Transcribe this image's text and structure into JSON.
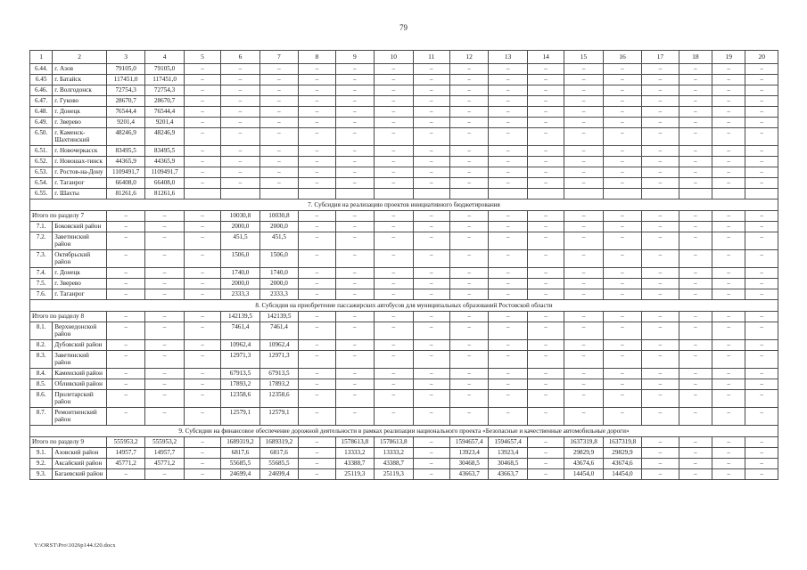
{
  "document": {
    "page_number": "79",
    "footer_path": "Y:\\ORST\\Pro\\1026p144.f20.docx"
  },
  "table": {
    "column_numbers": [
      "1",
      "2",
      "3",
      "4",
      "5",
      "6",
      "7",
      "8",
      "9",
      "10",
      "11",
      "12",
      "13",
      "14",
      "15",
      "16",
      "17",
      "18",
      "19",
      "20"
    ],
    "dash": "–",
    "blocks": [
      {
        "id": "block-6-continued",
        "section_header": null,
        "total_row": null,
        "rows": [
          {
            "num": "6.44.",
            "name": "г. Азов",
            "values": [
              "79105,0",
              "79105,0",
              "–",
              "–",
              "–",
              "–",
              "–",
              "–",
              "–",
              "–",
              "–",
              "–",
              "–",
              "–",
              "–",
              "–",
              "–",
              "–"
            ]
          },
          {
            "num": "6.45",
            "name": "г. Батайск",
            "values": [
              "117451,0",
              "117451,0",
              "–",
              "–",
              "–",
              "–",
              "–",
              "–",
              "–",
              "–",
              "–",
              "–",
              "–",
              "–",
              "–",
              "–",
              "–",
              "–"
            ]
          },
          {
            "num": "6.46.",
            "name": "г. Волгодонск",
            "values": [
              "72754,3",
              "72754,3",
              "–",
              "–",
              "–",
              "–",
              "–",
              "–",
              "–",
              "–",
              "–",
              "–",
              "–",
              "–",
              "–",
              "–",
              "–",
              "–"
            ]
          },
          {
            "num": "6.47.",
            "name": "г. Гуково",
            "values": [
              "28670,7",
              "28670,7",
              "–",
              "–",
              "–",
              "–",
              "–",
              "–",
              "–",
              "–",
              "–",
              "–",
              "–",
              "–",
              "–",
              "–",
              "–",
              "–"
            ]
          },
          {
            "num": "6.48.",
            "name": "г. Донецк",
            "values": [
              "76544,4",
              "76544,4",
              "–",
              "–",
              "–",
              "–",
              "–",
              "–",
              "–",
              "–",
              "–",
              "–",
              "–",
              "–",
              "–",
              "–",
              "–",
              "–"
            ]
          },
          {
            "num": "6.49.",
            "name": "г. Зверево",
            "values": [
              "9201,4",
              "9201,4",
              "–",
              "–",
              "–",
              "–",
              "–",
              "–",
              "–",
              "–",
              "–",
              "–",
              "–",
              "–",
              "–",
              "–",
              "–",
              "–"
            ]
          },
          {
            "num": "6.50.",
            "name": "г. Каменск-Шахтинский",
            "values": [
              "48246,9",
              "48246,9",
              "–",
              "–",
              "–",
              "–",
              "–",
              "–",
              "–",
              "–",
              "–",
              "–",
              "–",
              "–",
              "–",
              "–",
              "–",
              "–"
            ]
          },
          {
            "num": "6.51.",
            "name": "г. Новочеркасск",
            "values": [
              "83495,5",
              "83495,5",
              "–",
              "–",
              "–",
              "–",
              "–",
              "–",
              "–",
              "–",
              "–",
              "–",
              "–",
              "–",
              "–",
              "–",
              "–",
              "–"
            ]
          },
          {
            "num": "6.52.",
            "name": "г. Новошах-тинск",
            "values": [
              "44365,9",
              "44365,9",
              "–",
              "–",
              "–",
              "–",
              "–",
              "–",
              "–",
              "–",
              "–",
              "–",
              "–",
              "–",
              "–",
              "–",
              "–",
              "–"
            ]
          },
          {
            "num": "6.53.",
            "name": "г. Ростов-на-Дону",
            "values": [
              "1109491,7",
              "1109491,7",
              "–",
              "–",
              "–",
              "–",
              "–",
              "–",
              "–",
              "–",
              "–",
              "–",
              "–",
              "–",
              "–",
              "–",
              "–",
              "–"
            ]
          },
          {
            "num": "6.54.",
            "name": "г. Таганрог",
            "values": [
              "66408,0",
              "66408,0",
              "–",
              "–",
              "–",
              "–",
              "–",
              "–",
              "–",
              "–",
              "–",
              "–",
              "–",
              "–",
              "–",
              "–",
              "–",
              "–"
            ]
          },
          {
            "num": "6.55.",
            "name": "г. Шахты",
            "values": [
              "81261,6",
              "81261,6",
              "",
              "",
              "",
              "",
              "",
              "",
              "",
              "",
              "",
              "",
              "",
              "",
              "",
              "",
              "",
              ""
            ]
          }
        ]
      },
      {
        "id": "block-7",
        "section_header": "7. Субсидия на реализацию проектов инициативного бюджетирования",
        "total_row": {
          "label": "Итого по разделу 7",
          "values": [
            "–",
            "–",
            "–",
            "10030,8",
            "10030,8",
            "–",
            "–",
            "–",
            "–",
            "–",
            "–",
            "–",
            "–",
            "–",
            "–",
            "–",
            "–",
            "–"
          ]
        },
        "rows": [
          {
            "num": "7.1.",
            "name": "Боковский район",
            "values": [
              "–",
              "–",
              "–",
              "2000,0",
              "2000,0",
              "–",
              "–",
              "–",
              "–",
              "–",
              "–",
              "–",
              "–",
              "–",
              "–",
              "–",
              "–",
              "–"
            ]
          },
          {
            "num": "7.2.",
            "name": "Заветинский район",
            "values": [
              "–",
              "–",
              "–",
              "451,5",
              "451,5",
              "–",
              "–",
              "–",
              "–",
              "–",
              "–",
              "–",
              "–",
              "–",
              "–",
              "–",
              "–",
              "–"
            ]
          },
          {
            "num": "7.3.",
            "name": "Октябрьский район",
            "values": [
              "–",
              "–",
              "–",
              "1506,0",
              "1506,0",
              "–",
              "–",
              "–",
              "–",
              "–",
              "–",
              "–",
              "–",
              "–",
              "–",
              "–",
              "–",
              "–"
            ]
          },
          {
            "num": "7.4.",
            "name": "г. Донецк",
            "values": [
              "–",
              "–",
              "–",
              "1740,0",
              "1740,0",
              "–",
              "–",
              "–",
              "–",
              "–",
              "–",
              "–",
              "–",
              "–",
              "–",
              "–",
              "–",
              "–"
            ]
          },
          {
            "num": "7.5.",
            "name": "г. Зверево",
            "values": [
              "–",
              "–",
              "–",
              "2000,0",
              "2000,0",
              "–",
              "–",
              "–",
              "–",
              "–",
              "–",
              "–",
              "–",
              "–",
              "–",
              "–",
              "–",
              "–"
            ]
          },
          {
            "num": "7.6.",
            "name": "г. Таганрог",
            "values": [
              "–",
              "–",
              "–",
              "2333,3",
              "2333,3",
              "–",
              "–",
              "–",
              "–",
              "–",
              "–",
              "–",
              "–",
              "–",
              "–",
              "–",
              "–",
              "–"
            ]
          }
        ]
      },
      {
        "id": "block-8",
        "section_header": "8. Субсидия на приобретение пассажирских автобусов для муниципальных образований Ростовской области",
        "total_row": {
          "label": "Итого по разделу 8",
          "values": [
            "–",
            "–",
            "–",
            "142139,5",
            "142139,5",
            "–",
            "–",
            "–",
            "–",
            "–",
            "–",
            "–",
            "–",
            "–",
            "–",
            "–",
            "–",
            "–"
          ]
        },
        "rows": [
          {
            "num": "8.1.",
            "name": "Верхнедонской район",
            "values": [
              "–",
              "–",
              "–",
              "7461,4",
              "7461,4",
              "–",
              "–",
              "–",
              "–",
              "–",
              "–",
              "–",
              "–",
              "–",
              "–",
              "–",
              "–",
              "–"
            ]
          },
          {
            "num": "8.2.",
            "name": "Дубовский район",
            "values": [
              "–",
              "–",
              "–",
              "10962,4",
              "10962,4",
              "–",
              "–",
              "–",
              "–",
              "–",
              "–",
              "–",
              "–",
              "–",
              "–",
              "–",
              "–",
              "–"
            ]
          },
          {
            "num": "8.3.",
            "name": "Заветинский район",
            "values": [
              "–",
              "–",
              "–",
              "12971,3",
              "12971,3",
              "–",
              "–",
              "–",
              "–",
              "–",
              "–",
              "–",
              "–",
              "–",
              "–",
              "–",
              "–",
              "–"
            ]
          },
          {
            "num": "8.4.",
            "name": "Каменский район",
            "values": [
              "–",
              "–",
              "–",
              "67913,5",
              "67913,5",
              "–",
              "–",
              "–",
              "–",
              "–",
              "–",
              "–",
              "–",
              "–",
              "–",
              "–",
              "–",
              "–"
            ]
          },
          {
            "num": "8.5.",
            "name": "Обливский район",
            "values": [
              "–",
              "–",
              "–",
              "17893,2",
              "17893,2",
              "–",
              "–",
              "–",
              "–",
              "–",
              "–",
              "–",
              "–",
              "–",
              "–",
              "–",
              "–",
              "–"
            ]
          },
          {
            "num": "8.6.",
            "name": "Пролетарский район",
            "values": [
              "–",
              "–",
              "–",
              "12358,6",
              "12358,6",
              "–",
              "–",
              "–",
              "–",
              "–",
              "–",
              "–",
              "–",
              "–",
              "–",
              "–",
              "–",
              "–"
            ]
          },
          {
            "num": "8.7.",
            "name": "Ремонтненский район",
            "values": [
              "–",
              "–",
              "–",
              "12579,1",
              "12579,1",
              "–",
              "–",
              "–",
              "–",
              "–",
              "–",
              "–",
              "–",
              "–",
              "–",
              "–",
              "–",
              "–"
            ]
          }
        ]
      },
      {
        "id": "block-9",
        "section_header": "9. Субсидии на финансовое обеспечение дорожной деятельности в рамках реализации национального проекта «Безопасные и качественные автомобильные дороги»",
        "total_row": {
          "label": "Итого по разделу 9",
          "values": [
            "555953,2",
            "555953,2",
            "–",
            "1689319,2",
            "1689319,2",
            "–",
            "1578613,8",
            "1578613,8",
            "–",
            "1594657,4",
            "1594657,4",
            "–",
            "1637319,8",
            "1637319,8",
            "–",
            "–",
            "–",
            "–"
          ]
        },
        "rows": [
          {
            "num": "9.1.",
            "name": "Азовский район",
            "values": [
              "14957,7",
              "14957,7",
              "–",
              "6817,6",
              "6817,6",
              "–",
              "13333,2",
              "13333,2",
              "–",
              "13923,4",
              "13923,4",
              "–",
              "29829,9",
              "29829,9",
              "–",
              "–",
              "–",
              "–"
            ]
          },
          {
            "num": "9.2.",
            "name": "Аксайский район",
            "values": [
              "45771,2",
              "45771,2",
              "–",
              "55685,5",
              "55685,5",
              "–",
              "43388,7",
              "43388,7",
              "–",
              "30468,5",
              "30468,5",
              "–",
              "43674,6",
              "43674,6",
              "–",
              "–",
              "–",
              "–"
            ]
          },
          {
            "num": "9.3.",
            "name": "Багаевский район",
            "values": [
              "–",
              "–",
              "–",
              "24699,4",
              "24699,4",
              "–",
              "25119,3",
              "25119,3",
              "–",
              "43663,7",
              "43663,7",
              "–",
              "14454,0",
              "14454,0",
              "–",
              "–",
              "–",
              "–"
            ]
          }
        ]
      }
    ]
  }
}
